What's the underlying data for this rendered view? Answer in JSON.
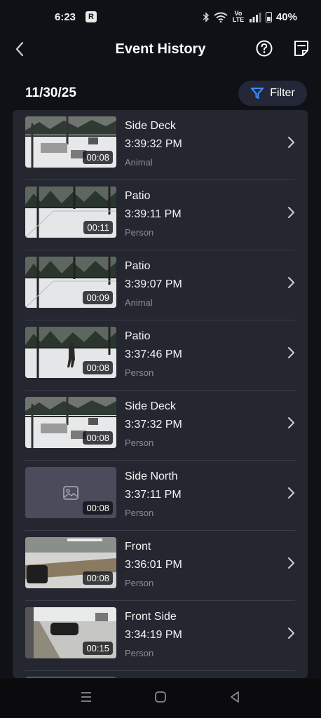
{
  "status_bar": {
    "time": "6:23",
    "app_badge": "R",
    "network": "Vo LTE",
    "battery": "40%"
  },
  "header": {
    "title": "Event History"
  },
  "date": "11/30/25",
  "filter": {
    "label": "Filter"
  },
  "events": [
    {
      "camera": "Side Deck",
      "time": "3:39:32 PM",
      "type": "Animal",
      "duration": "00:08",
      "thumb": "deck"
    },
    {
      "camera": "Patio",
      "time": "3:39:11 PM",
      "type": "Person",
      "duration": "00:11",
      "thumb": "patio"
    },
    {
      "camera": "Patio",
      "time": "3:39:07 PM",
      "type": "Animal",
      "duration": "00:09",
      "thumb": "patio"
    },
    {
      "camera": "Patio",
      "time": "3:37:46 PM",
      "type": "Person",
      "duration": "00:08",
      "thumb": "patio-person"
    },
    {
      "camera": "Side Deck",
      "time": "3:37:32 PM",
      "type": "Person",
      "duration": "00:08",
      "thumb": "deck"
    },
    {
      "camera": "Side North",
      "time": "3:37:11 PM",
      "type": "Person",
      "duration": "00:08",
      "thumb": "placeholder"
    },
    {
      "camera": "Front",
      "time": "3:36:01 PM",
      "type": "Person",
      "duration": "00:08",
      "thumb": "front"
    },
    {
      "camera": "Front Side",
      "time": "3:34:19 PM",
      "type": "Person",
      "duration": "00:15",
      "thumb": "frontside"
    }
  ],
  "colors": {
    "background": "#101116",
    "card": "#242630",
    "accent": "#3b8cff",
    "secondary_text": "#8a8c96"
  }
}
